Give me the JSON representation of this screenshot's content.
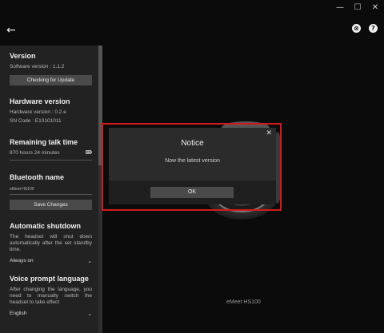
{
  "window": {
    "minimize": "—",
    "maximize": "☐",
    "close": "✕"
  },
  "header": {
    "back_glyph": "←",
    "xbox_glyph": "⊗",
    "help_glyph": "?"
  },
  "sidebar": {
    "version": {
      "title": "Version",
      "software": "Software version : 1.1.2",
      "button": "Checking for Update"
    },
    "hardware": {
      "title": "Hardware version",
      "hardware": "Hardware version : 0.2.e",
      "sn": "SN Code : E10101011"
    },
    "talk": {
      "title": "Remaining talk time",
      "value": "870 hours 24 minutes"
    },
    "bluetooth": {
      "title": "Bluetooth name",
      "value": "eMeet HS100",
      "button": "Save Changes"
    },
    "shutdown": {
      "title": "Automatic shutdown",
      "desc": "The headset will shut down automatically after the set standby time.",
      "selected": "Always on"
    },
    "language": {
      "title": "Voice prompt language",
      "desc": "After changing the language, you need to manually switch the headset to take effect",
      "selected": "English"
    }
  },
  "device_label": "eMeet HS100",
  "dialog": {
    "title": "Notice",
    "message": "Now the latest version",
    "ok": "OK",
    "close": "✕"
  }
}
